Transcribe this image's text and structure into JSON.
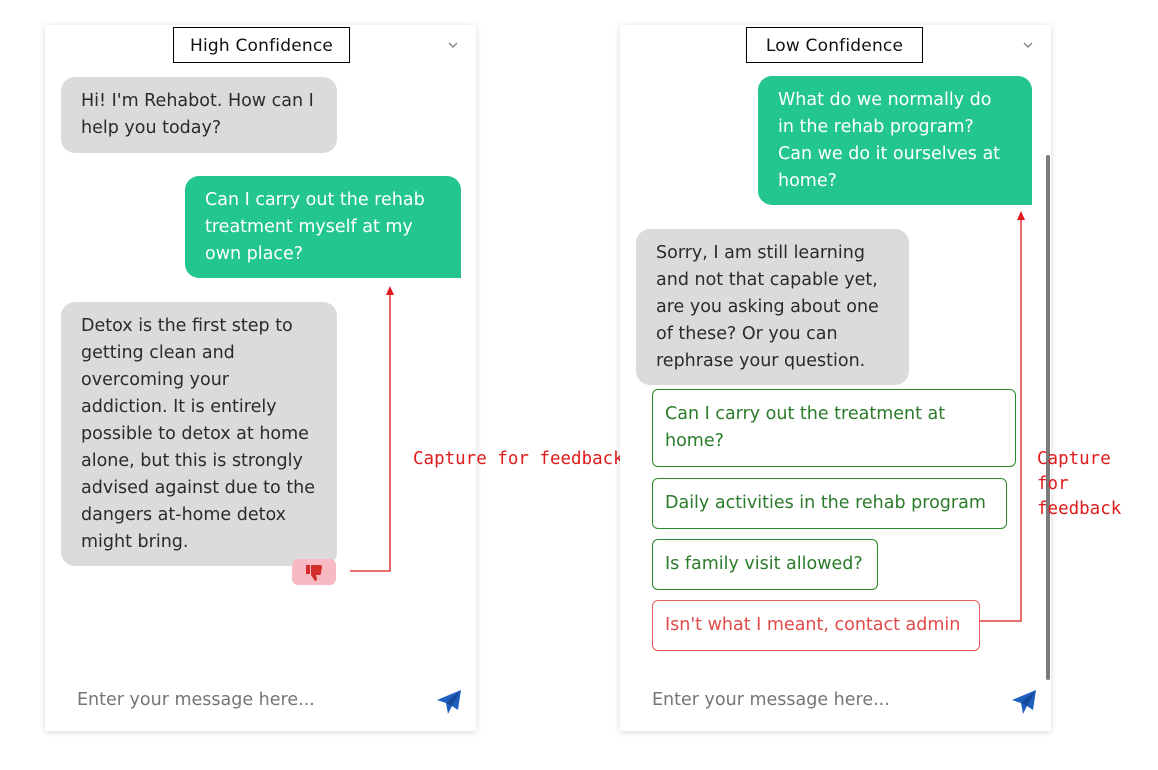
{
  "left": {
    "title": "High Confidence",
    "messages": {
      "bot_greeting": "Hi! I'm Rehabot. How can I help you today?",
      "user_question": "Can I carry out the rehab treatment myself at my own place?",
      "bot_answer": "Detox is the first step to getting clean and overcoming your addiction. It is entirely possible to detox at home alone, but this is strongly advised against due to the dangers at-home detox might bring."
    },
    "input_placeholder": "Enter your message here...",
    "annotation": "Capture for feedback"
  },
  "right": {
    "title": "Low Confidence",
    "messages": {
      "user_question": "What do we normally do in the rehab program? Can we do it ourselves at home?",
      "bot_fallback": "Sorry, I am still learning and not that capable yet, are you asking about one of these? Or you can rephrase your question."
    },
    "options": [
      "Can I carry out the treatment at home?",
      "Daily activities in the rehab program",
      "Is family visit allowed?",
      "Isn't what I meant, contact admin"
    ],
    "input_placeholder": "Enter your message here...",
    "annotation": "Capture for feedback"
  },
  "colors": {
    "user_bubble": "#22c68e",
    "bot_bubble": "#dcdadb",
    "option_border": "#2a8a2a",
    "admin_option": "#e04a4a",
    "annotation_red": "#e01b1b",
    "send_icon": "#1f5fbf"
  },
  "icons": {
    "dropdown": "chevron-down-icon",
    "send": "paper-plane-icon",
    "feedback": "thumbs-down-icon"
  }
}
